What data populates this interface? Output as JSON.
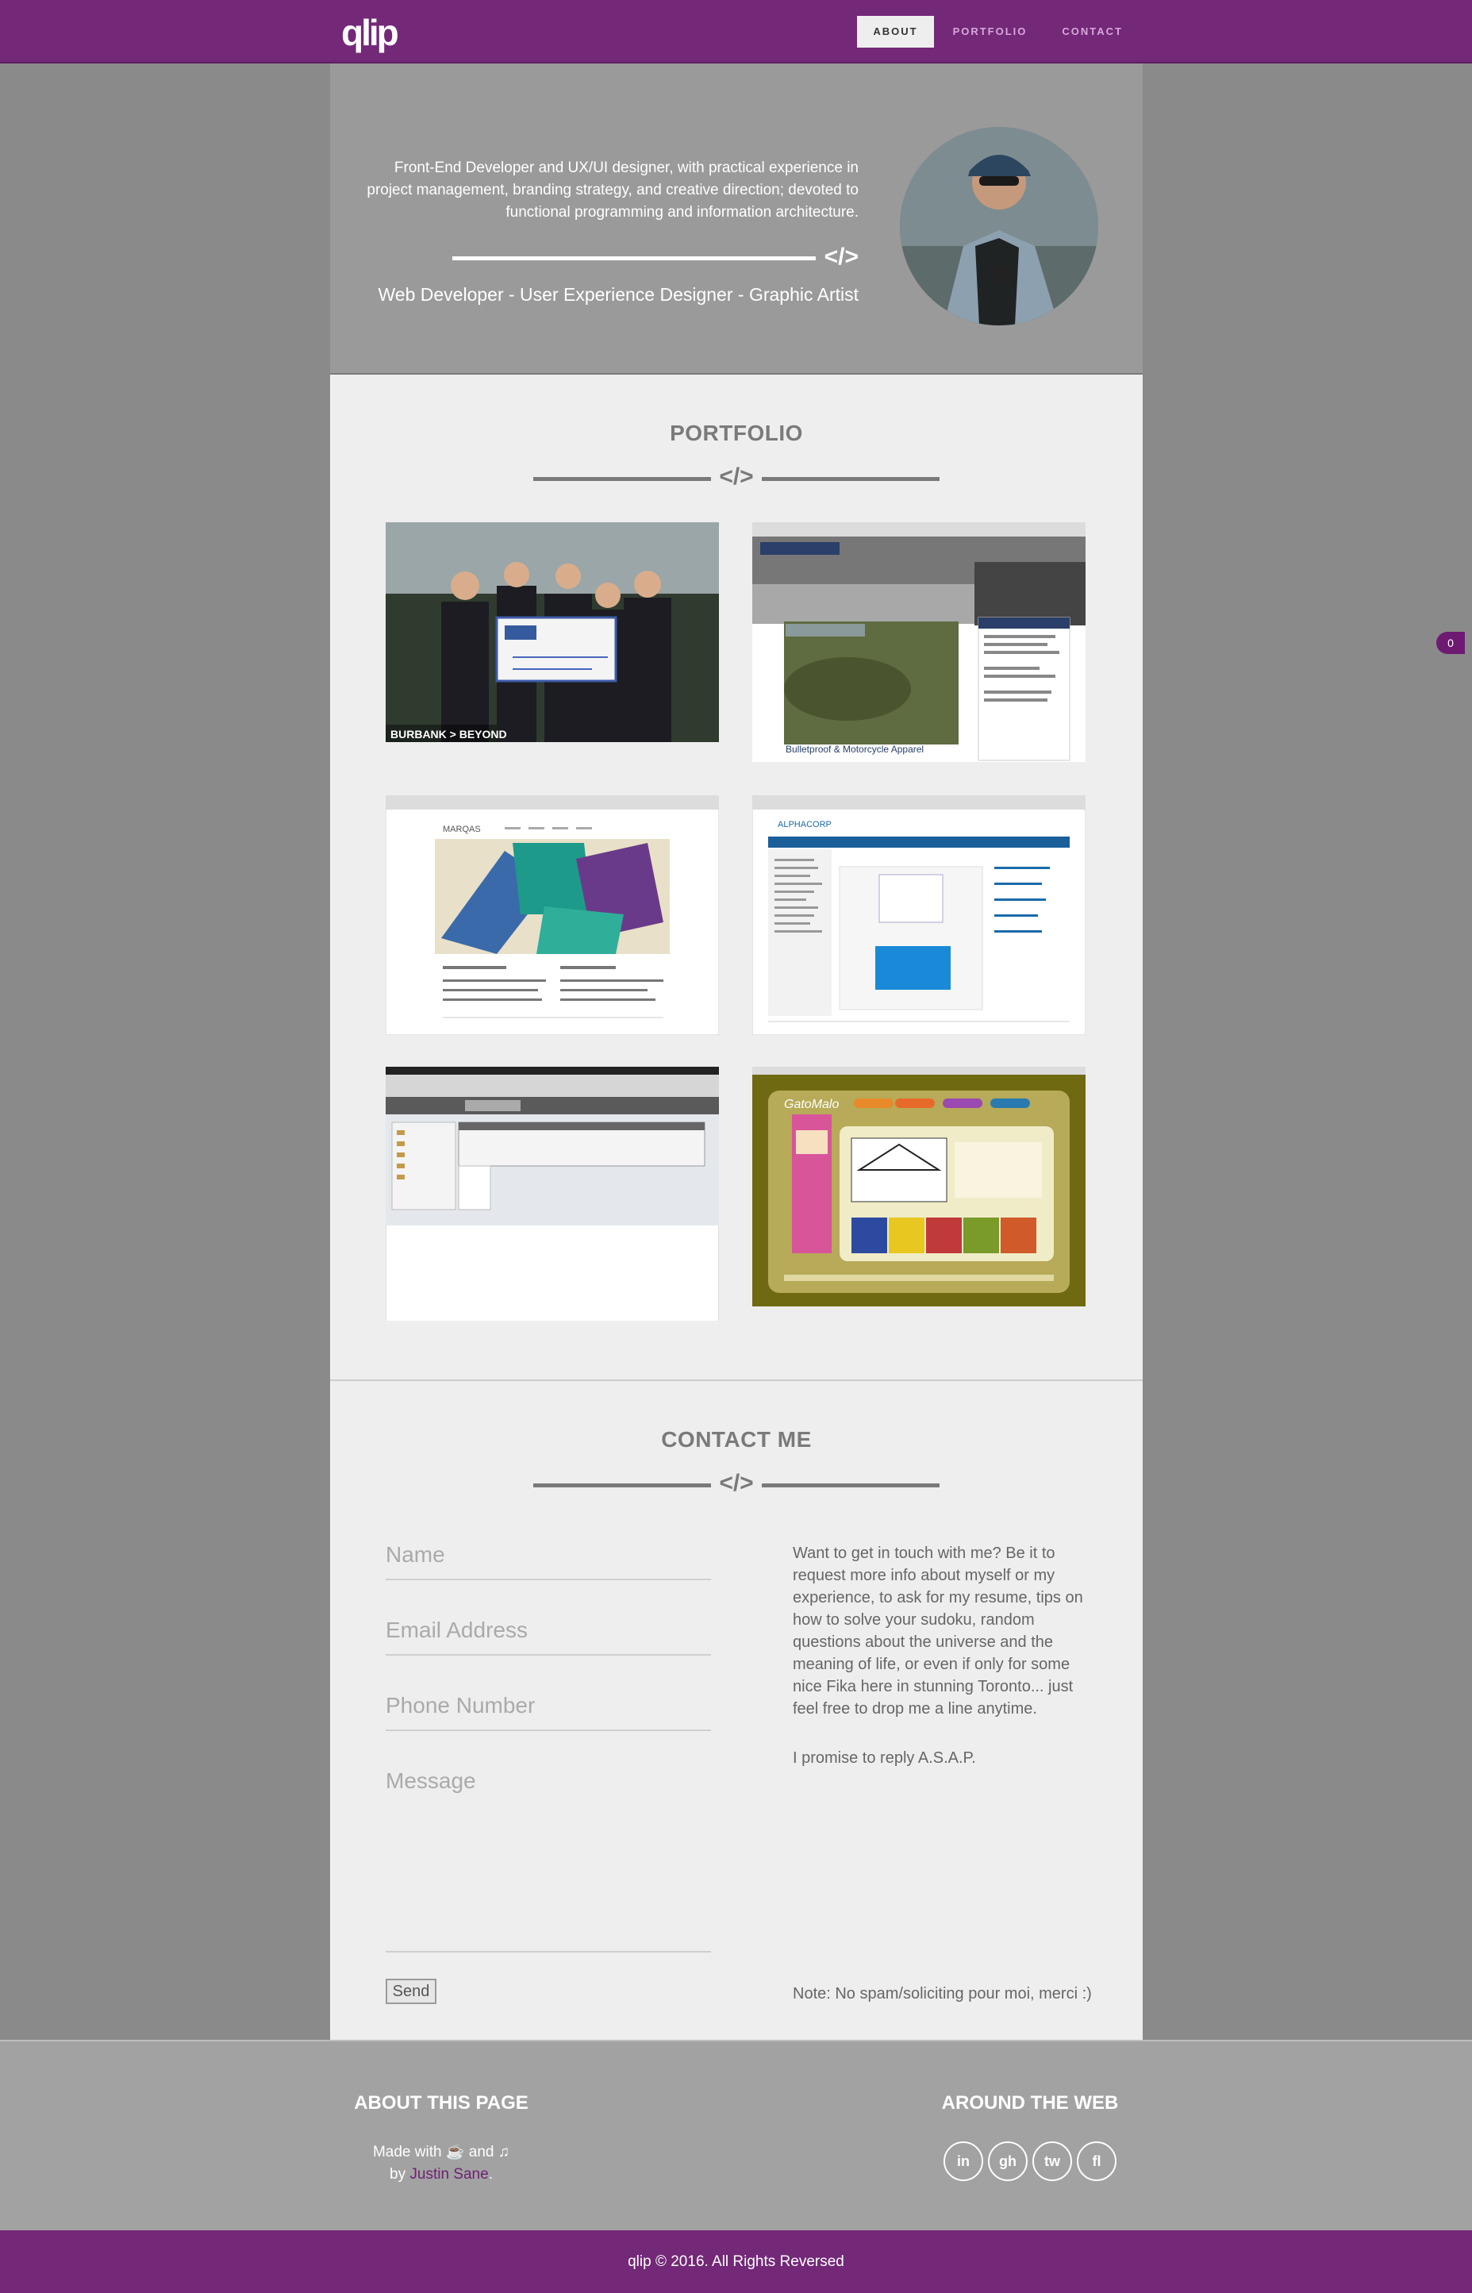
{
  "header": {
    "logo": "qlip",
    "nav": [
      {
        "label": "ABOUT",
        "active": true
      },
      {
        "label": "PORTFOLIO",
        "active": false
      },
      {
        "label": "CONTACT",
        "active": false
      }
    ]
  },
  "about": {
    "intro": "Front-End Developer and UX/UI designer, with practical experience in project management, branding strategy, and creative direction; devoted to functional programming and information architecture.",
    "code_glyph": "</>",
    "tagline": "Web Developer - User Experience Designer - Graphic Artist"
  },
  "portfolio": {
    "title": "PORTFOLIO",
    "code_glyph": "</>",
    "items": [
      {
        "caption": "BURBANK > BEYOND"
      },
      {
        "caption": "Bulletproof & Motorcycle Apparel"
      },
      {
        "caption": "MARQAS"
      },
      {
        "caption": "ALPHACORP"
      },
      {
        "caption": ""
      },
      {
        "caption": "GatoMalo"
      }
    ]
  },
  "contact": {
    "title": "CONTACT ME",
    "code_glyph": "</>",
    "name_placeholder": "Name",
    "email_placeholder": "Email Address",
    "phone_placeholder": "Phone Number",
    "message_placeholder": "Message",
    "send_label": "Send",
    "text_1": "Want to get in touch with me? Be it to request more info about myself or my experience, to ask for my resume, tips on how to solve your sudoku, random questions about the universe and the meaning of life, or even if only for some nice Fika here in stunning Toronto... just feel free to drop me a line anytime.",
    "text_2": "I promise to reply A.S.A.P.",
    "note": "Note: No spam/soliciting pour moi, merci :)"
  },
  "footer": {
    "about_title": "ABOUT THIS PAGE",
    "made_with": "Made with",
    "and": "and",
    "by": "by",
    "author": "Justin Sane",
    "period": ".",
    "web_title": "AROUND THE WEB",
    "social": [
      {
        "label": "in",
        "icon": "linkedin-icon"
      },
      {
        "label": "gh",
        "icon": "github-icon"
      },
      {
        "label": "tw",
        "icon": "twitter-icon"
      },
      {
        "label": "fl",
        "icon": "flickr-icon"
      }
    ],
    "copyright": "qlip © 2016. All Rights Reversed"
  },
  "badge": "0",
  "colors": {
    "brand_purple": "#732878",
    "page_gray": "#8a8a8a",
    "panel_light": "#eeeeee"
  }
}
